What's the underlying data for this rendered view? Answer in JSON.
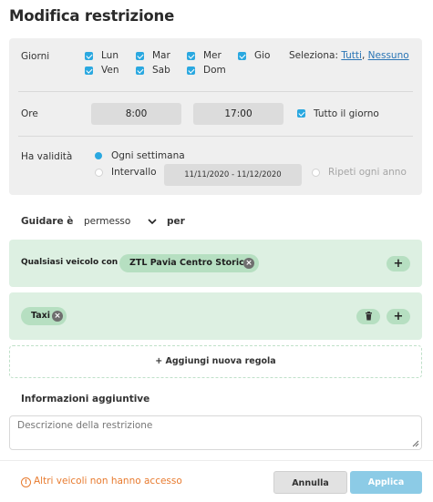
{
  "title": "Modifica restrizione",
  "days": {
    "label": "Giorni",
    "items": [
      {
        "label": "Lun",
        "checked": true
      },
      {
        "label": "Mar",
        "checked": true
      },
      {
        "label": "Mer",
        "checked": true
      },
      {
        "label": "Gio",
        "checked": true
      },
      {
        "label": "Ven",
        "checked": true
      },
      {
        "label": "Sab",
        "checked": true
      },
      {
        "label": "Dom",
        "checked": true
      }
    ],
    "select_label": "Seleziona:",
    "select_all": "Tutti",
    "select_none": "Nessuno"
  },
  "hours": {
    "label": "Ore",
    "start": "8:00",
    "end": "17:00",
    "all_day_label": "Tutto il giorno",
    "all_day_checked": true
  },
  "validity": {
    "label": "Ha validità",
    "weekly_label": "Ogni settimana",
    "weekly_selected": true,
    "interval_label": "Intervallo",
    "interval_selected": false,
    "interval_value": "11/11/2020 - 11/12/2020",
    "repeat_yearly_label": "Ripeti ogni anno"
  },
  "driving": {
    "label": "Guidare è",
    "mode": "permesso",
    "suffix": "per"
  },
  "rules": [
    {
      "prefix": "Qualsiasi veicolo con",
      "chip": "ZTL Pavia Centro Storico",
      "add": "+"
    },
    {
      "chip": "Taxi",
      "add": "+"
    }
  ],
  "add_rule_label": "+ Aggiungi nuova regola",
  "extra_info": {
    "label": "Informazioni aggiuntive",
    "placeholder": "Descrizione della restrizione"
  },
  "footer": {
    "warning": "Altri veicoli non hanno accesso",
    "cancel": "Annulla",
    "apply": "Applica"
  },
  "colors": {
    "accent": "#2aa8e0",
    "rule_background": "#ddf0e2",
    "chip": "#b6dfc1",
    "warning": "#e87b2f",
    "apply_button": "#8ccbe6"
  }
}
